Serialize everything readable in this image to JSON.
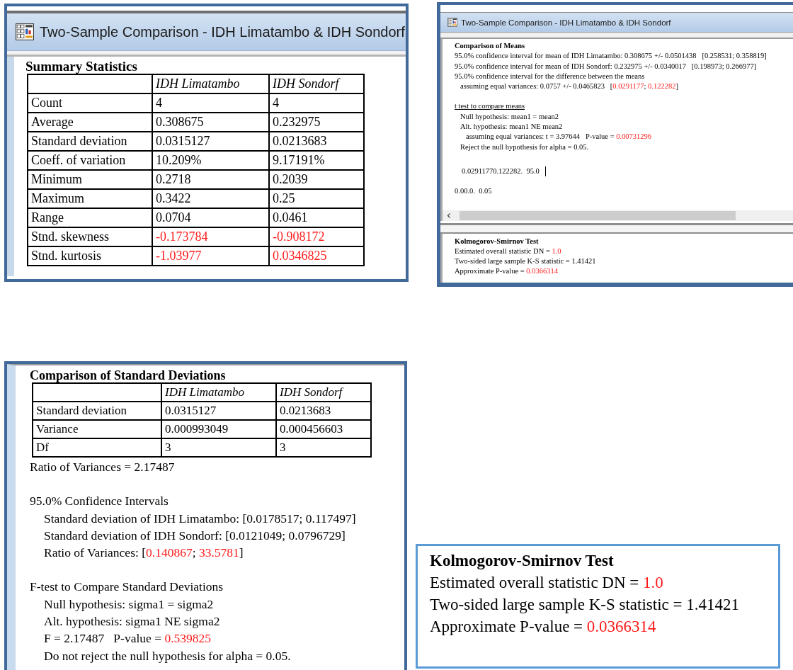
{
  "summary_window": {
    "title": "Two-Sample Comparison - IDH Limatambo & IDH Sondorf",
    "heading": "Summary Statistics",
    "columns": [
      "IDH Limatambo",
      "IDH Sondorf"
    ],
    "rows": [
      {
        "label": "Count",
        "values": [
          {
            "text": "4",
            "flagged": false
          },
          {
            "text": "4",
            "flagged": false
          }
        ]
      },
      {
        "label": "Average",
        "values": [
          {
            "text": "0.308675",
            "flagged": false
          },
          {
            "text": "0.232975",
            "flagged": false
          }
        ]
      },
      {
        "label": "Standard deviation",
        "values": [
          {
            "text": "0.0315127",
            "flagged": false
          },
          {
            "text": "0.0213683",
            "flagged": false
          }
        ]
      },
      {
        "label": "Coeff. of variation",
        "values": [
          {
            "text": "10.209%",
            "flagged": false
          },
          {
            "text": "9.17191%",
            "flagged": false
          }
        ]
      },
      {
        "label": "Minimum",
        "values": [
          {
            "text": "0.2718",
            "flagged": false
          },
          {
            "text": "0.2039",
            "flagged": false
          }
        ]
      },
      {
        "label": "Maximum",
        "values": [
          {
            "text": "0.3422",
            "flagged": false
          },
          {
            "text": "0.25",
            "flagged": false
          }
        ]
      },
      {
        "label": "Range",
        "values": [
          {
            "text": "0.0704",
            "flagged": false
          },
          {
            "text": "0.0461",
            "flagged": false
          }
        ]
      },
      {
        "label": "Stnd. skewness",
        "values": [
          {
            "text": "-0.173784",
            "flagged": true
          },
          {
            "text": "-0.908172",
            "flagged": true
          }
        ]
      },
      {
        "label": "Stnd. kurtosis",
        "values": [
          {
            "text": "-1.03977",
            "flagged": true
          },
          {
            "text": "0.0346825",
            "flagged": true
          }
        ]
      }
    ]
  },
  "comparison_window": {
    "title": "Two-Sample Comparison - IDH Limatambo & IDH Sondorf",
    "output_pane": {
      "blocks": [
        [
          {
            "kind": "heading",
            "parts": [
              {
                "text": "Comparison of Means",
                "flagged": false
              }
            ]
          },
          {
            "kind": "text",
            "parts": [
              {
                "text": "95.0% confidence interval for mean of IDH Limatambo: 0.308675 +/- 0.0501438   [0.258531; 0.358819]",
                "flagged": false
              }
            ]
          },
          {
            "kind": "text",
            "parts": [
              {
                "text": "95.0% confidence interval for mean of IDH Sondorf: 0.232975 +/- 0.0340017   [0.198973; 0.266977]",
                "flagged": false
              }
            ]
          },
          {
            "kind": "text",
            "parts": [
              {
                "text": "95.0% confidence interval for the difference between the means",
                "flagged": false
              }
            ],
            "children": [
              {
                "kind": "text",
                "parts": [
                  {
                    "text": "assuming equal variances: 0.0757 +/- 0.0465823   [",
                    "flagged": false
                  },
                  {
                    "text": "0.0291177",
                    "flagged": true
                  },
                  {
                    "text": "; ",
                    "flagged": false
                  },
                  {
                    "text": "0.122282",
                    "flagged": true
                  },
                  {
                    "text": "]",
                    "flagged": false
                  }
                ]
              }
            ]
          }
        ],
        [
          {
            "kind": "link",
            "parts": [
              {
                "text": "t test to compare means",
                "flagged": false
              }
            ],
            "children": [
              {
                "kind": "text",
                "parts": [
                  {
                    "text": "Null hypothesis: mean1 = mean2",
                    "flagged": false
                  }
                ]
              },
              {
                "kind": "text",
                "parts": [
                  {
                    "text": "Alt. hypothesis: mean1 NE mean2",
                    "flagged": false
                  }
                ],
                "children": [
                  {
                    "kind": "text",
                    "parts": [
                      {
                        "text": "assuming equal variances: t = 3.97644   P-value = ",
                        "flagged": false
                      },
                      {
                        "text": "0.00731296",
                        "flagged": true
                      }
                    ]
                  }
                ]
              },
              {
                "kind": "text",
                "parts": [
                  {
                    "text": "Reject the null hypothesis for alpha = 0.05.",
                    "flagged": false
                  }
                ]
              }
            ]
          }
        ],
        [
          {
            "kind": "input",
            "parts": [
              {
                "text": "0.02911770.122282.  95.0",
                "flagged": false
              }
            ]
          }
        ],
        [
          {
            "kind": "text",
            "parts": [
              {
                "text": "0.00.0.  0.05",
                "flagged": false
              }
            ]
          }
        ]
      ]
    },
    "ks_pane": {
      "blocks": [
        [
          {
            "kind": "heading",
            "parts": [
              {
                "text": "Kolmogorov-Smirnov Test",
                "flagged": false
              }
            ]
          },
          {
            "kind": "text",
            "parts": [
              {
                "text": "Estimated overall statistic DN = ",
                "flagged": false
              },
              {
                "text": "1.0",
                "flagged": true
              }
            ]
          },
          {
            "kind": "text",
            "parts": [
              {
                "text": "Two-sided large sample K-S statistic = 1.41421",
                "flagged": false
              }
            ]
          },
          {
            "kind": "text",
            "parts": [
              {
                "text": "Approximate P-value = ",
                "flagged": false
              },
              {
                "text": "0.0366314",
                "flagged": true
              }
            ]
          }
        ]
      ]
    }
  },
  "std_dev_panel": {
    "heading": "Comparison of Standard Deviations",
    "columns": [
      "IDH Limatambo",
      "IDH Sondorf"
    ],
    "rows": [
      {
        "label": "Standard deviation",
        "values": [
          {
            "text": "0.0315127",
            "flagged": false
          },
          {
            "text": "0.0213683",
            "flagged": false
          }
        ]
      },
      {
        "label": "Variance",
        "values": [
          {
            "text": "0.000993049",
            "flagged": false
          },
          {
            "text": "0.000456603",
            "flagged": false
          }
        ]
      },
      {
        "label": "Df",
        "values": [
          {
            "text": "3",
            "flagged": false
          },
          {
            "text": "3",
            "flagged": false
          }
        ]
      }
    ],
    "blocks": [
      [
        {
          "kind": "text",
          "parts": [
            {
              "text": "Ratio of Variances = 2.17487",
              "flagged": false
            }
          ]
        }
      ],
      [
        {
          "kind": "text",
          "parts": [
            {
              "text": "95.0% Confidence Intervals",
              "flagged": false
            }
          ],
          "children": [
            {
              "kind": "text",
              "parts": [
                {
                  "text": "Standard deviation of IDH Limatambo: [0.0178517; 0.117497]",
                  "flagged": false
                }
              ]
            },
            {
              "kind": "text",
              "parts": [
                {
                  "text": "Standard deviation of IDH Sondorf: [0.0121049; 0.0796729]",
                  "flagged": false
                }
              ]
            },
            {
              "kind": "text",
              "parts": [
                {
                  "text": "Ratio of Variances: [",
                  "flagged": false
                },
                {
                  "text": "0.140867",
                  "flagged": true
                },
                {
                  "text": "; ",
                  "flagged": false
                },
                {
                  "text": "33.5781",
                  "flagged": true
                },
                {
                  "text": "]",
                  "flagged": false
                }
              ]
            }
          ]
        }
      ],
      [
        {
          "kind": "text",
          "parts": [
            {
              "text": "F-test to Compare Standard Deviations",
              "flagged": false
            }
          ],
          "children": [
            {
              "kind": "text",
              "parts": [
                {
                  "text": "Null hypothesis: sigma1 = sigma2",
                  "flagged": false
                }
              ]
            },
            {
              "kind": "text",
              "parts": [
                {
                  "text": "Alt. hypothesis: sigma1 NE sigma2",
                  "flagged": false
                }
              ]
            },
            {
              "kind": "text",
              "parts": [
                {
                  "text": "F = 2.17487   P-value = ",
                  "flagged": false
                },
                {
                  "text": "0.539825",
                  "flagged": true
                }
              ]
            },
            {
              "kind": "text",
              "parts": [
                {
                  "text": "Do not reject the null hypothesis for alpha = 0.05.",
                  "flagged": false
                }
              ]
            }
          ]
        }
      ]
    ]
  },
  "ks_panel": {
    "blocks": [
      [
        {
          "kind": "heading",
          "parts": [
            {
              "text": "Kolmogorov-Smirnov Test",
              "flagged": false
            }
          ]
        },
        {
          "kind": "text",
          "parts": [
            {
              "text": "Estimated overall statistic DN = ",
              "flagged": false
            },
            {
              "text": "1.0",
              "flagged": true
            }
          ]
        },
        {
          "kind": "text",
          "parts": [
            {
              "text": "Two-sided large sample K-S statistic = 1.41421",
              "flagged": false
            }
          ]
        },
        {
          "kind": "text",
          "parts": [
            {
              "text": "Approximate P-value = ",
              "flagged": false
            },
            {
              "text": "0.0366314",
              "flagged": true
            }
          ]
        }
      ]
    ]
  }
}
